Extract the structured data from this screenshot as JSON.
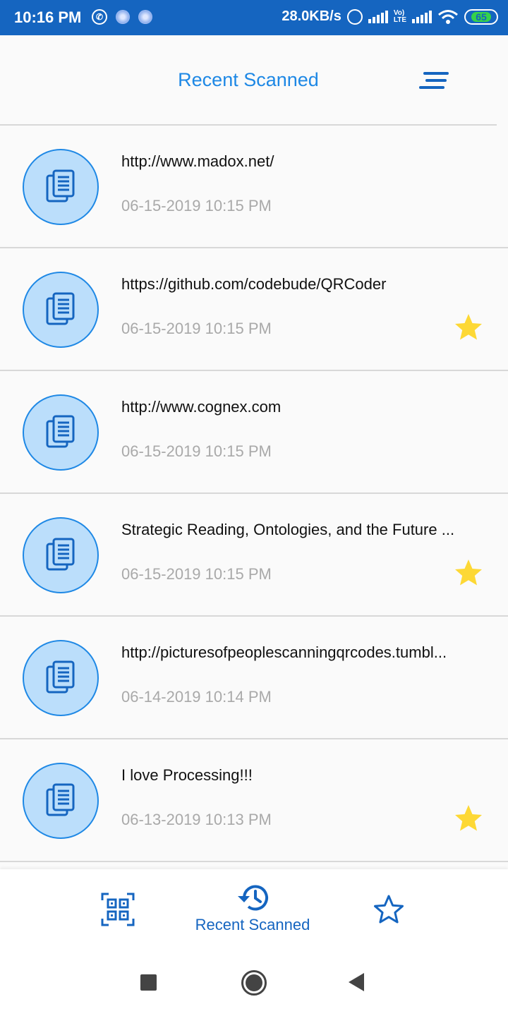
{
  "status_bar": {
    "time": "10:16 PM",
    "net_speed": "28.0KB/s",
    "lte_label": "Vo)\nLTE",
    "battery": "65",
    "icons": [
      "whatsapp-icon",
      "notification-dot-icon",
      "notification-dot-icon",
      "alarm-icon",
      "signal-icon",
      "lte-icon",
      "signal-icon",
      "wifi-icon",
      "battery-icon"
    ]
  },
  "app_bar": {
    "title": "Recent Scanned",
    "menu_icon": "sort-menu-icon"
  },
  "items": [
    {
      "title": "http://www.madox.net/",
      "date": "06-15-2019 10:15 PM",
      "starred": false
    },
    {
      "title": "https://github.com/codebude/QRCoder",
      "date": "06-15-2019 10:15 PM",
      "starred": true
    },
    {
      "title": "http://www.cognex.com",
      "date": "06-15-2019 10:15 PM",
      "starred": false
    },
    {
      "title": "Strategic Reading, Ontologies, and the Future ...",
      "date": "06-15-2019 10:15 PM",
      "starred": true
    },
    {
      "title": "http://picturesofpeoplescanningqrcodes.tumbl...",
      "date": "06-14-2019 10:14 PM",
      "starred": false
    },
    {
      "title": "I love Processing!!!",
      "date": "06-13-2019 10:13 PM",
      "starred": true
    }
  ],
  "bottom_nav": {
    "recent_label": "Recent Scanned",
    "active_tab": "recent",
    "icons": [
      "qr-scan-icon",
      "history-icon",
      "star-outline-icon"
    ]
  },
  "colors": {
    "primary": "#1565c0",
    "accent": "#1e88e5",
    "avatar_fill": "#bbdefb",
    "star": "#fdd835",
    "date_text": "#a9a9a9"
  }
}
